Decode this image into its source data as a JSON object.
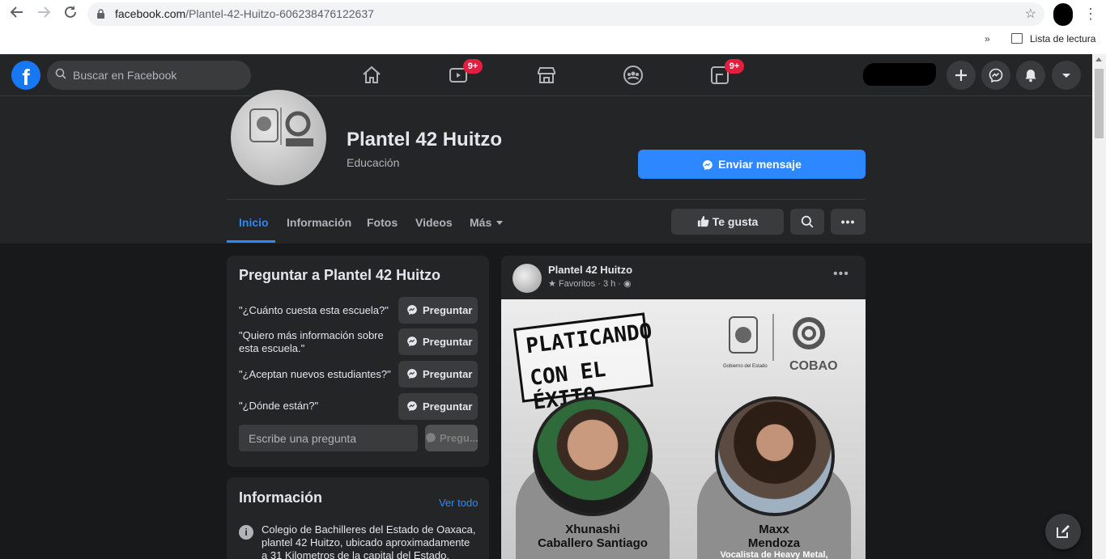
{
  "browser": {
    "url_domain": "facebook.com",
    "url_path": "/Plantel-42-Huitzo-606238476122637",
    "reading_list_label": "Lista de lectura",
    "bookmarks_overflow": "»"
  },
  "topbar": {
    "search_placeholder": "Buscar en Facebook",
    "watch_badge": "9+",
    "gaming_badge": "9+",
    "icons": [
      "home-icon",
      "watch-icon",
      "marketplace-icon",
      "groups-icon",
      "gaming-icon"
    ],
    "right_icons": [
      "plus-icon",
      "messenger-icon",
      "notifications-icon",
      "account-caret-icon"
    ]
  },
  "page": {
    "title": "Plantel 42 Huitzo",
    "category": "Educación",
    "send_message": "Enviar mensaje",
    "tabs": [
      {
        "label": "Inicio",
        "active": true
      },
      {
        "label": "Información"
      },
      {
        "label": "Fotos"
      },
      {
        "label": "Videos"
      },
      {
        "label": "Más"
      }
    ],
    "like_label": "Te gusta"
  },
  "ask": {
    "title": "Preguntar a Plantel 42 Huitzo",
    "questions": [
      "\"¿Cuánto cuesta esta escuela?\"",
      "\"Quiero más información sobre esta escuela.\"",
      "\"¿Aceptan nuevos estudiantes?\"",
      "\"¿Dónde están?\""
    ],
    "button_label": "Preguntar",
    "input_placeholder": "Escribe una pregunta",
    "disabled_button_label": "Pregu..."
  },
  "info": {
    "title": "Información",
    "see_all": "Ver todo",
    "description": "Colegio de Bachilleres del Estado de Oaxaca, plantel 42 Huitzo, ubicado aproximadamente a 31 Kilometros de la capital del Estado."
  },
  "post": {
    "author": "Plantel 42 Huitzo",
    "meta": "Favoritos · 3 h ·",
    "image": {
      "banner_line1": "PLATICANDO",
      "banner_line2": "CON EL ÉXITO",
      "logo_caption_left": "Gobierno del Estado",
      "logo_caption_right": "COBAO",
      "guest1_first": "Xhunashi",
      "guest1_last": "Caballero Santiago",
      "guest2_first": "Maxx",
      "guest2_last": "Mendoza",
      "guest2_role": "Vocalista de Heavy Metal,"
    }
  },
  "colors": {
    "fb_blue": "#1877f2",
    "accent_blue": "#2d88ff",
    "badge_red": "#e41e3f",
    "surface": "#242526",
    "background": "#18191a"
  }
}
